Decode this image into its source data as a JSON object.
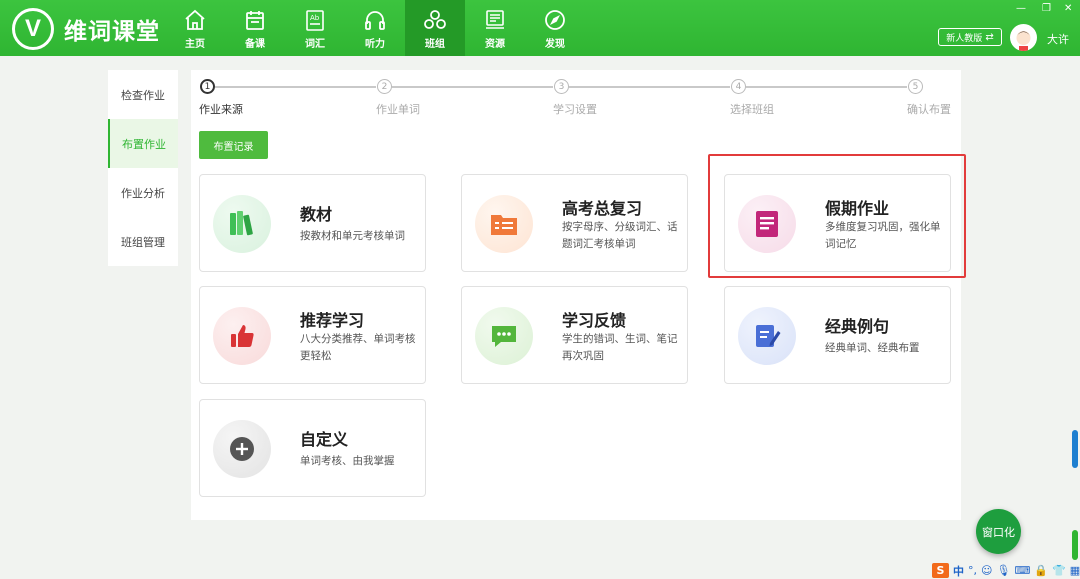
{
  "app": {
    "logo_letter": "V",
    "name": "维词课堂"
  },
  "nav": [
    {
      "label": "主页",
      "icon": "home-icon"
    },
    {
      "label": "备课",
      "icon": "calendar-icon"
    },
    {
      "label": "词汇",
      "icon": "vocabulary-icon"
    },
    {
      "label": "听力",
      "icon": "headphones-icon"
    },
    {
      "label": "班组",
      "icon": "class-group-icon",
      "active": true
    },
    {
      "label": "资源",
      "icon": "resources-icon"
    },
    {
      "label": "发现",
      "icon": "compass-icon"
    }
  ],
  "header": {
    "new_version_label": "新人教版",
    "username": "大许"
  },
  "sidebar": {
    "items": [
      {
        "label": "检查作业"
      },
      {
        "label": "布置作业",
        "active": true
      },
      {
        "label": "作业分析"
      },
      {
        "label": "班组管理"
      }
    ]
  },
  "steps": [
    {
      "num": "1",
      "label": "作业来源",
      "active": true
    },
    {
      "num": "2",
      "label": "作业单词"
    },
    {
      "num": "3",
      "label": "学习设置"
    },
    {
      "num": "4",
      "label": "选择班组"
    },
    {
      "num": "5",
      "label": "确认布置"
    }
  ],
  "record_button": "布置记录",
  "cards": [
    {
      "title": "教材",
      "desc": "按教材和单元考核单词",
      "icon": "books-icon",
      "color": "#3fbf56"
    },
    {
      "title": "高考总复习",
      "desc": "按字母序、分级词汇、话题词汇考核单词",
      "icon": "folder-icon",
      "color": "#f0793a"
    },
    {
      "title": "假期作业",
      "desc": "多维度复习巩固，强化单词记忆",
      "icon": "homework-list-icon",
      "color": "#c2277a"
    },
    {
      "title": "推荐学习",
      "desc": "八大分类推荐、单词考核更轻松",
      "icon": "thumbs-up-icon",
      "color": "#d93436"
    },
    {
      "title": "学习反馈",
      "desc": "学生的错词、生词、笔记再次巩固",
      "icon": "chat-icon",
      "color": "#53b63c"
    },
    {
      "title": "经典例句",
      "desc": "经典单词、经典布置",
      "icon": "edit-note-icon",
      "color": "#4a6fd6"
    },
    {
      "title": "自定义",
      "desc": "单词考核、由我掌握",
      "icon": "plus-icon",
      "color": "#555555"
    }
  ],
  "float_button": "窗口化",
  "taskbar": {
    "ime_logo": "S",
    "ime_lang": "中"
  }
}
